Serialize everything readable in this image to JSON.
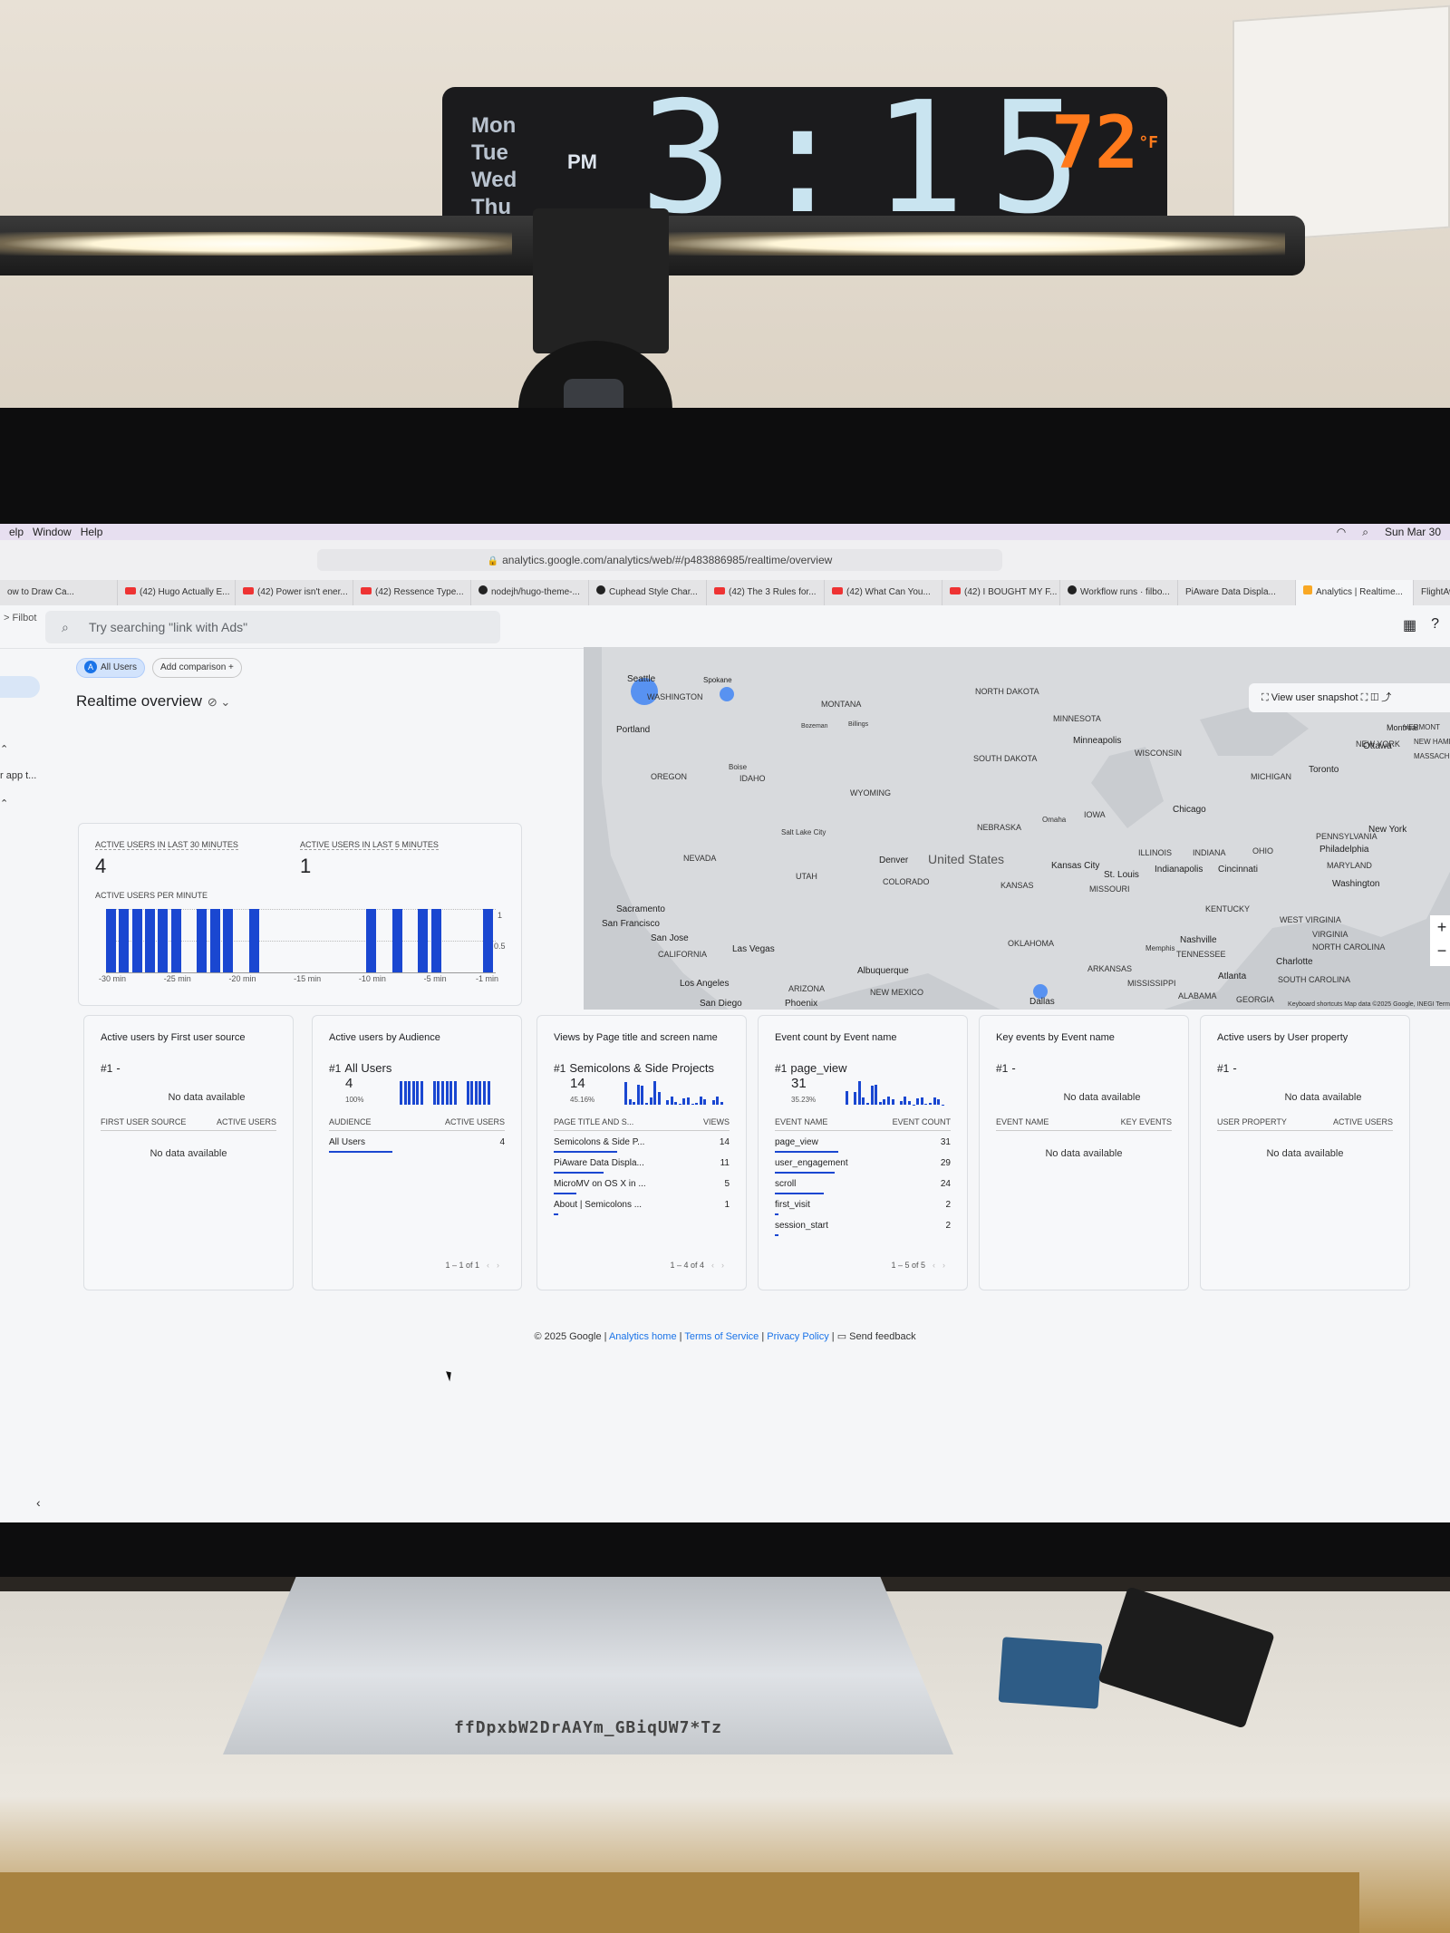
{
  "clock": {
    "days": [
      "Mon",
      "Tue",
      "Wed",
      "Thu"
    ],
    "ampm": "PM",
    "time": "3:15",
    "temp": "72",
    "temp_unit": "°F"
  },
  "menubar": {
    "items": [
      "elp",
      "Window",
      "Help"
    ],
    "datetime": "Sun Mar 30"
  },
  "browser": {
    "url": "analytics.google.com/analytics/web/#/p483886985/realtime/overview",
    "tabs": [
      {
        "label": "ow to Draw Ca...",
        "icon": "none"
      },
      {
        "label": "(42) Hugo Actually E...",
        "icon": "youtube"
      },
      {
        "label": "(42) Power isn't ener...",
        "icon": "youtube"
      },
      {
        "label": "(42) Ressence Type...",
        "icon": "youtube"
      },
      {
        "label": "nodejh/hugo-theme-...",
        "icon": "github"
      },
      {
        "label": "Cuphead Style Char...",
        "icon": "github"
      },
      {
        "label": "(42) The 3 Rules for...",
        "icon": "youtube"
      },
      {
        "label": "(42) What Can You...",
        "icon": "youtube"
      },
      {
        "label": "(42) I BOUGHT MY F...",
        "icon": "youtube"
      },
      {
        "label": "Workflow runs · filbo...",
        "icon": "github"
      },
      {
        "label": "PiAware Data Displa...",
        "icon": "none"
      },
      {
        "label": "Analytics | Realtime...",
        "icon": "analytics"
      },
      {
        "label": "FlightAware",
        "icon": "none"
      }
    ]
  },
  "app": {
    "breadcrumb": "> Filbot",
    "search_placeholder": "Try searching \"link with Ads\"",
    "sidebar_texts": [
      "r app t..."
    ],
    "chips": {
      "all_users": "All Users",
      "avatar": "A",
      "add_comparison": "Add comparison"
    },
    "page_title": "Realtime overview",
    "view_snapshot": "View user snapshot",
    "map": {
      "country": "United States",
      "states": [
        "WASHINGTON",
        "MONTANA",
        "NORTH DAKOTA",
        "MINNESOTA",
        "OREGON",
        "IDAHO",
        "WYOMING",
        "SOUTH DAKOTA",
        "WISCONSIN",
        "MICHIGAN",
        "NEBRASKA",
        "IOWA",
        "NEVADA",
        "UTAH",
        "COLORADO",
        "KANSAS",
        "MISSOURI",
        "ILLINOIS",
        "INDIANA",
        "OHIO",
        "PENNSYLVANIA",
        "CALIFORNIA",
        "ARIZONA",
        "NEW MEXICO",
        "OKLAHOMA",
        "ARKANSAS",
        "TENNESSEE",
        "KENTUCKY",
        "WEST VIRGINIA",
        "VIRGINIA",
        "MARYLAND",
        "NORTH CAROLINA",
        "SOUTH CAROLINA",
        "MISSISSIPPI",
        "ALABAMA",
        "GEORGIA",
        "NEW YORK",
        "VERMONT",
        "NEW HAMPS",
        "MASSACHU"
      ],
      "cities": [
        "Seattle",
        "Spokane",
        "Portland",
        "Bozeman",
        "Billings",
        "Boise",
        "Minneapolis",
        "Ottawa",
        "Montreal",
        "Toronto",
        "Chicago",
        "Omaha",
        "Salt Lake City",
        "Denver",
        "Kansas City",
        "St. Louis",
        "Indianapolis",
        "Cincinnati",
        "Philadelphia",
        "New York",
        "Washington",
        "Sacramento",
        "San Francisco",
        "San Jose",
        "Las Vegas",
        "Los Angeles",
        "San Diego",
        "Phoenix",
        "Albuquerque",
        "Dallas",
        "Nashville",
        "Memphis",
        "Charlotte",
        "Atlanta"
      ],
      "footer": "Keyboard shortcuts   Map data ©2025 Google, INEGI   Term"
    },
    "summary": {
      "label_30": "ACTIVE USERS IN LAST 30 MINUTES",
      "value_30": "4",
      "label_5": "ACTIVE USERS IN LAST 5 MINUTES",
      "value_5": "1",
      "label_pm": "ACTIVE USERS PER MINUTE",
      "x_ticks": [
        "-30 min",
        "-25 min",
        "-20 min",
        "-15 min",
        "-10 min",
        "-5 min",
        "-1 min"
      ],
      "y_ticks": [
        "1",
        "0.5"
      ]
    },
    "cards": [
      {
        "title": "Active users by First user source",
        "rank": "#1",
        "top": "-",
        "nodata": "No data available",
        "cols": [
          "FIRST USER SOURCE",
          "ACTIVE USERS"
        ],
        "nodata2": "No data available"
      },
      {
        "title": "Active users by Audience",
        "rank": "#1",
        "top": "All Users",
        "value": "4",
        "pct": "100%",
        "cols": [
          "AUDIENCE",
          "ACTIVE USERS"
        ],
        "rows": [
          {
            "name": "All Users",
            "value": "4",
            "share": 1
          }
        ],
        "pager": "1 – 1 of 1"
      },
      {
        "title": "Views by Page title and screen name",
        "rank": "#1",
        "top": "Semicolons & Side Projects",
        "value": "14",
        "pct": "45.16%",
        "cols": [
          "PAGE TITLE AND S...",
          "VIEWS"
        ],
        "rows": [
          {
            "name": "Semicolons & Side P...",
            "value": "14",
            "share": 1
          },
          {
            "name": "PiAware Data Displa...",
            "value": "11",
            "share": 0.79
          },
          {
            "name": "MicroMV on OS X in ...",
            "value": "5",
            "share": 0.36
          },
          {
            "name": "About | Semicolons ...",
            "value": "1",
            "share": 0.07
          }
        ],
        "pager": "1 – 4 of 4"
      },
      {
        "title": "Event count by Event name",
        "rank": "#1",
        "top": "page_view",
        "value": "31",
        "pct": "35.23%",
        "cols": [
          "EVENT NAME",
          "EVENT COUNT"
        ],
        "rows": [
          {
            "name": "page_view",
            "value": "31",
            "share": 1
          },
          {
            "name": "user_engagement",
            "value": "29",
            "share": 0.94
          },
          {
            "name": "scroll",
            "value": "24",
            "share": 0.77
          },
          {
            "name": "first_visit",
            "value": "2",
            "share": 0.06
          },
          {
            "name": "session_start",
            "value": "2",
            "share": 0.06
          }
        ],
        "pager": "1 – 5 of 5"
      },
      {
        "title": "Key events by Event name",
        "rank": "#1",
        "top": "-",
        "nodata": "No data available",
        "cols": [
          "EVENT NAME",
          "KEY EVENTS"
        ],
        "nodata2": "No data available"
      },
      {
        "title": "Active users by User property",
        "rank": "#1",
        "top": "-",
        "nodata": "No data available",
        "cols": [
          "USER PROPERTY",
          "ACTIVE USERS"
        ],
        "nodata2": "No data available"
      }
    ],
    "footer": {
      "copyright": "© 2025 Google |",
      "home": "Analytics home",
      "sep1": "|",
      "terms": "Terms of Service",
      "sep2": "|",
      "privacy": "Privacy Policy",
      "sep3": "|",
      "feedback": "Send feedback"
    }
  },
  "stand": {
    "serial": "ffDpxbW2DrAAYm_GBiqUW7*Tz"
  },
  "chart_data": {
    "type": "bar",
    "title": "ACTIVE USERS PER MINUTE",
    "x": [
      -30,
      -29,
      -28,
      -27,
      -26,
      -25,
      -23,
      -22,
      -21,
      -19,
      -10,
      -8,
      -6,
      -5,
      -1
    ],
    "values": [
      1,
      1,
      1,
      1,
      1,
      1,
      1,
      1,
      1,
      1,
      1,
      1,
      1,
      1,
      1
    ],
    "xlim": [
      -30,
      -1
    ],
    "ylim": [
      0,
      1
    ],
    "x_ticks": [
      "-30 min",
      "-25 min",
      "-20 min",
      "-15 min",
      "-10 min",
      "-5 min",
      "-1 min"
    ],
    "y_ticks": [
      "1",
      "0.5"
    ]
  },
  "colors": {
    "bar": "#1a47d1",
    "accent": "#1a73e8",
    "clock_time": "#c9e4f0",
    "clock_temp": "#ff7a1c"
  }
}
